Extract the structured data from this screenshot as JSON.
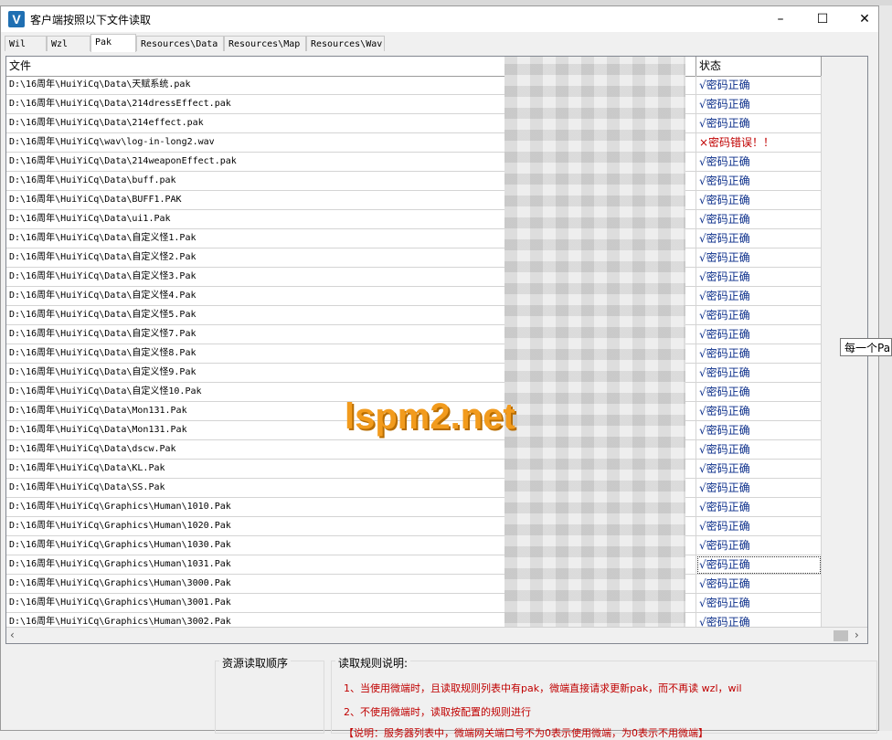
{
  "window": {
    "title": "客户端按照以下文件读取"
  },
  "tabs": [
    "Wil",
    "Wzl",
    "Pak",
    "Resources\\Data",
    "Resources\\Map",
    "Resources\\Wav"
  ],
  "grid": {
    "columns": {
      "file": "文件",
      "status": "状态"
    },
    "rows": [
      {
        "file": "D:\\16周年\\HuiYiCq\\Data\\天赋系统.pak",
        "status": "√密码正确"
      },
      {
        "file": "D:\\16周年\\HuiYiCq\\Data\\214dressEffect.pak",
        "status": "√密码正确"
      },
      {
        "file": "D:\\16周年\\HuiYiCq\\Data\\214effect.pak",
        "status": "√密码正确"
      },
      {
        "file": "D:\\16周年\\HuiYiCq\\wav\\log-in-long2.wav",
        "status": "×密码错误！！"
      },
      {
        "file": "D:\\16周年\\HuiYiCq\\Data\\214weaponEffect.pak",
        "status": "√密码正确"
      },
      {
        "file": "D:\\16周年\\HuiYiCq\\Data\\buff.pak",
        "status": "√密码正确"
      },
      {
        "file": "D:\\16周年\\HuiYiCq\\Data\\BUFF1.PAK",
        "status": "√密码正确"
      },
      {
        "file": "D:\\16周年\\HuiYiCq\\Data\\ui1.Pak",
        "status": "√密码正确"
      },
      {
        "file": "D:\\16周年\\HuiYiCq\\Data\\自定义怪1.Pak",
        "status": "√密码正确"
      },
      {
        "file": "D:\\16周年\\HuiYiCq\\Data\\自定义怪2.Pak",
        "status": "√密码正确"
      },
      {
        "file": "D:\\16周年\\HuiYiCq\\Data\\自定义怪3.Pak",
        "status": "√密码正确"
      },
      {
        "file": "D:\\16周年\\HuiYiCq\\Data\\自定义怪4.Pak",
        "status": "√密码正确"
      },
      {
        "file": "D:\\16周年\\HuiYiCq\\Data\\自定义怪5.Pak",
        "status": "√密码正确"
      },
      {
        "file": "D:\\16周年\\HuiYiCq\\Data\\自定义怪7.Pak",
        "status": "√密码正确"
      },
      {
        "file": "D:\\16周年\\HuiYiCq\\Data\\自定义怪8.Pak",
        "status": "√密码正确"
      },
      {
        "file": "D:\\16周年\\HuiYiCq\\Data\\自定义怪9.Pak",
        "status": "√密码正确"
      },
      {
        "file": "D:\\16周年\\HuiYiCq\\Data\\自定义怪10.Pak",
        "status": "√密码正确"
      },
      {
        "file": "D:\\16周年\\HuiYiCq\\Data\\Mon131.Pak",
        "status": "√密码正确"
      },
      {
        "file": "D:\\16周年\\HuiYiCq\\Data\\Mon131.Pak",
        "status": "√密码正确"
      },
      {
        "file": "D:\\16周年\\HuiYiCq\\Data\\dscw.Pak",
        "status": "√密码正确"
      },
      {
        "file": "D:\\16周年\\HuiYiCq\\Data\\KL.Pak",
        "status": "√密码正确"
      },
      {
        "file": "D:\\16周年\\HuiYiCq\\Data\\SS.Pak",
        "status": "√密码正确"
      },
      {
        "file": "D:\\16周年\\HuiYiCq\\Graphics\\Human\\1010.Pak",
        "status": "√密码正确"
      },
      {
        "file": "D:\\16周年\\HuiYiCq\\Graphics\\Human\\1020.Pak",
        "status": "√密码正确"
      },
      {
        "file": "D:\\16周年\\HuiYiCq\\Graphics\\Human\\1030.Pak",
        "status": "√密码正确"
      },
      {
        "file": "D:\\16周年\\HuiYiCq\\Graphics\\Human\\1031.Pak",
        "status": "√密码正确"
      },
      {
        "file": "D:\\16周年\\HuiYiCq\\Graphics\\Human\\3000.Pak",
        "status": "√密码正确"
      },
      {
        "file": "D:\\16周年\\HuiYiCq\\Graphics\\Human\\3001.Pak",
        "status": "√密码正确"
      },
      {
        "file": "D:\\16周年\\HuiYiCq\\Graphics\\Human\\3002.Pak",
        "status": "√密码正确"
      }
    ]
  },
  "watermark": "lspm2.net",
  "tooltip": "每一个Pak",
  "bottom": {
    "order_label": "资源读取顺序",
    "rules_label": "读取规则说明:",
    "rules": [
      "1、当使用微端时，且读取规则列表中有pak，微端直接请求更新pak，而不再读 wzl，wil",
      "2、不使用微端时，读取按配置的规则进行",
      "【说明：服务器列表中，微端网关端口号不为0表示使用微端，为0表示不用微端】"
    ]
  },
  "colors": {
    "ok": "#0b2e8a",
    "error": "#c00000",
    "watermark": "#f29b1d"
  }
}
